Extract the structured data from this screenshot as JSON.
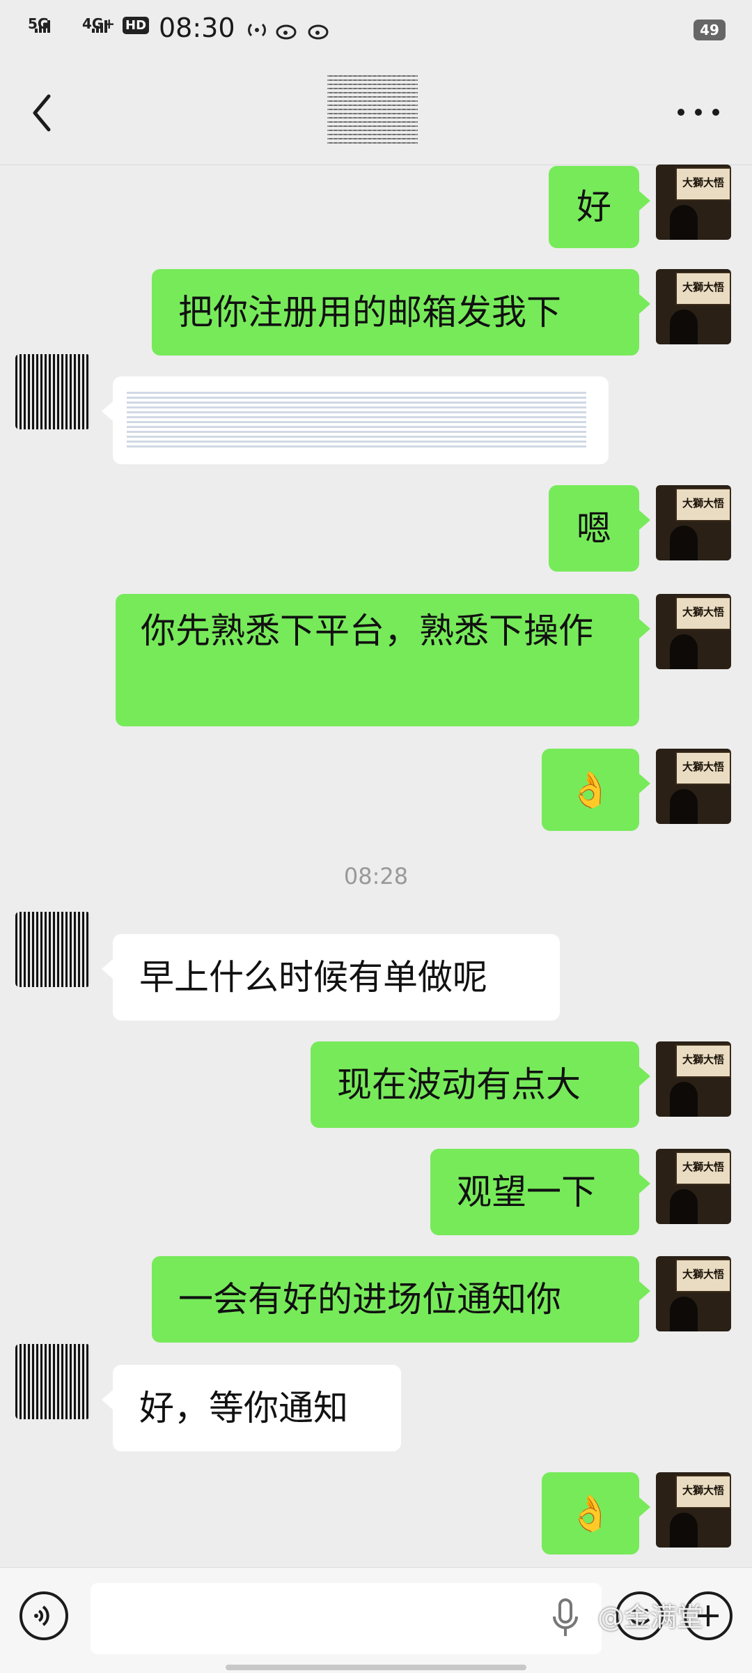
{
  "status_bar": {
    "network_1": "5G",
    "network_2": "4G+",
    "hd_label": "HD",
    "time": "08:30",
    "battery": "49"
  },
  "messages": [
    {
      "side": "me",
      "text": "好"
    },
    {
      "side": "me",
      "text": "把你注册用的邮箱发我下"
    },
    {
      "side": "them",
      "text": ""
    },
    {
      "side": "me",
      "text": "嗯"
    },
    {
      "side": "me",
      "text": "你先熟悉下平台，熟悉下操作"
    },
    {
      "side": "me",
      "text": "👌"
    },
    {
      "side": "time",
      "text": "08:28"
    },
    {
      "side": "them",
      "text": "早上什么时候有单做呢"
    },
    {
      "side": "me",
      "text": "现在波动有点大"
    },
    {
      "side": "me",
      "text": "观望一下"
    },
    {
      "side": "me",
      "text": "一会有好的进场位通知你"
    },
    {
      "side": "them",
      "text": "好，等你通知"
    },
    {
      "side": "me",
      "text": "👌"
    }
  ],
  "avatar_sign_text": "大獅大悟",
  "watermark": "@金满堂",
  "colors": {
    "my_bubble": "#77ea5a",
    "their_bubble": "#ffffff",
    "background": "#ededed"
  }
}
